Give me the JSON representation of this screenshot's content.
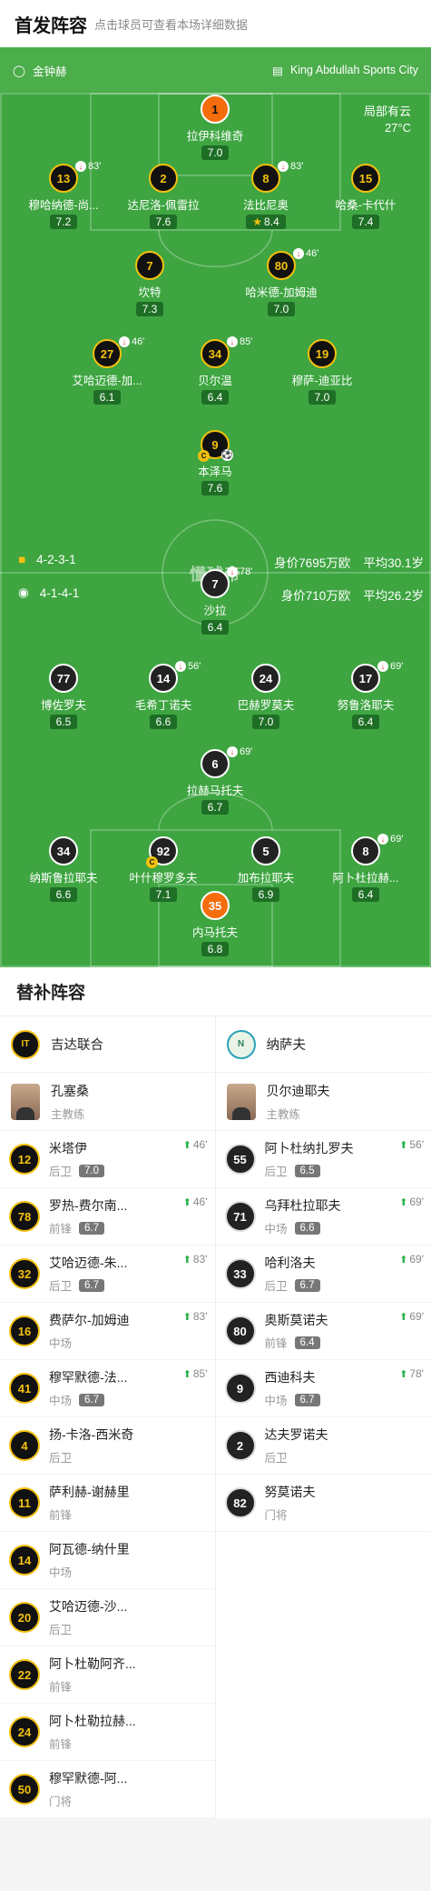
{
  "header": {
    "title": "首发阵容",
    "subtitle": "点击球员可查看本场详细数据"
  },
  "info": {
    "referee": "金钟赫",
    "stadium": "King Abdullah Sports City",
    "weather": "局部有云",
    "temperature": "27°C"
  },
  "home_lineup": {
    "formation": "4-2-3-1",
    "value_label": "身价7695万欧",
    "age_label": "平均30.1岁",
    "players": [
      {
        "num": "1",
        "name": "拉伊科维奇",
        "rating": "7.0",
        "gk": true
      },
      {
        "num": "13",
        "name": "穆哈纳德-尚...",
        "rating": "7.2",
        "sub": "83'"
      },
      {
        "num": "2",
        "name": "达尼洛-佩雷拉",
        "rating": "7.6"
      },
      {
        "num": "8",
        "name": "法比尼奥",
        "rating": "8.4",
        "sub": "83'",
        "star": true
      },
      {
        "num": "15",
        "name": "哈桑-卡代什",
        "rating": "7.4"
      },
      {
        "num": "7",
        "name": "坎特",
        "rating": "7.3"
      },
      {
        "num": "80",
        "name": "哈米德-加姆迪",
        "rating": "7.0",
        "sub": "46'"
      },
      {
        "num": "27",
        "name": "艾哈迈德-加...",
        "rating": "6.1",
        "sub": "46'"
      },
      {
        "num": "34",
        "name": "贝尔温",
        "rating": "6.4",
        "sub": "85'"
      },
      {
        "num": "19",
        "name": "穆萨-迪亚比",
        "rating": "7.0"
      },
      {
        "num": "9",
        "name": "本泽马",
        "rating": "7.6",
        "captain": true,
        "goal": true
      }
    ]
  },
  "away_lineup": {
    "formation": "4-1-4-1",
    "value_label": "身价710万欧",
    "age_label": "平均26.2岁",
    "players": [
      {
        "num": "7",
        "name": "沙拉",
        "rating": "6.4",
        "sub": "78'"
      },
      {
        "num": "77",
        "name": "博佐罗夫",
        "rating": "6.5"
      },
      {
        "num": "14",
        "name": "毛希丁诺夫",
        "rating": "6.6",
        "sub": "56'"
      },
      {
        "num": "24",
        "name": "巴赫罗莫夫",
        "rating": "7.0"
      },
      {
        "num": "17",
        "name": "努鲁洛耶夫",
        "rating": "6.4",
        "sub": "69'"
      },
      {
        "num": "6",
        "name": "拉赫马托夫",
        "rating": "6.7",
        "sub": "69'"
      },
      {
        "num": "34",
        "name": "纳斯鲁拉耶夫",
        "rating": "6.6"
      },
      {
        "num": "92",
        "name": "叶什穆罗多夫",
        "rating": "7.1",
        "captain": true
      },
      {
        "num": "5",
        "name": "加布拉耶夫",
        "rating": "6.9"
      },
      {
        "num": "8",
        "name": "阿卜杜拉赫...",
        "rating": "6.4",
        "sub": "69'"
      },
      {
        "num": "35",
        "name": "内马托夫",
        "rating": "6.8",
        "gk": true
      }
    ]
  },
  "watermark": "懂球帝",
  "subs": {
    "title": "替补阵容",
    "home": {
      "team": "吉达联合",
      "coach": "孔塞桑",
      "coach_role": "主教练",
      "players": [
        {
          "num": "12",
          "name": "米塔伊",
          "pos": "后卫",
          "rating": "7.0",
          "time": "46'"
        },
        {
          "num": "78",
          "name": "罗热-费尔南...",
          "pos": "前锋",
          "rating": "6.7",
          "time": "46'"
        },
        {
          "num": "32",
          "name": "艾哈迈德-朱...",
          "pos": "后卫",
          "rating": "6.7",
          "time": "83'"
        },
        {
          "num": "16",
          "name": "费萨尔-加姆迪",
          "pos": "中场",
          "rating": "",
          "time": "83'"
        },
        {
          "num": "41",
          "name": "穆罕默德-法...",
          "pos": "中场",
          "rating": "6.7",
          "time": "85'"
        },
        {
          "num": "4",
          "name": "扬-卡洛-西米奇",
          "pos": "后卫",
          "rating": "",
          "time": ""
        },
        {
          "num": "11",
          "name": "萨利赫-谢赫里",
          "pos": "前锋",
          "rating": "",
          "time": ""
        },
        {
          "num": "14",
          "name": "阿瓦德-纳什里",
          "pos": "中场",
          "rating": "",
          "time": ""
        },
        {
          "num": "20",
          "name": "艾哈迈德-沙...",
          "pos": "后卫",
          "rating": "",
          "time": ""
        },
        {
          "num": "22",
          "name": "阿卜杜勒阿齐...",
          "pos": "前锋",
          "rating": "",
          "time": ""
        },
        {
          "num": "24",
          "name": "阿卜杜勒拉赫...",
          "pos": "前锋",
          "rating": "",
          "time": ""
        },
        {
          "num": "50",
          "name": "穆罕默德-阿...",
          "pos": "门将",
          "rating": "",
          "time": ""
        }
      ]
    },
    "away": {
      "team": "纳萨夫",
      "coach": "贝尔迪耶夫",
      "coach_role": "主教练",
      "players": [
        {
          "num": "55",
          "name": "阿卜杜纳扎罗夫",
          "pos": "后卫",
          "rating": "6.5",
          "time": "56'"
        },
        {
          "num": "71",
          "name": "乌拜杜拉耶夫",
          "pos": "中场",
          "rating": "6.6",
          "time": "69'"
        },
        {
          "num": "33",
          "name": "哈利洛夫",
          "pos": "后卫",
          "rating": "6.7",
          "time": "69'"
        },
        {
          "num": "80",
          "name": "奥斯莫诺夫",
          "pos": "前锋",
          "rating": "6.4",
          "time": "69'"
        },
        {
          "num": "9",
          "name": "西迪科夫",
          "pos": "中场",
          "rating": "6.7",
          "time": "78'"
        },
        {
          "num": "2",
          "name": "达夫罗诺夫",
          "pos": "后卫",
          "rating": "",
          "time": ""
        },
        {
          "num": "82",
          "name": "努莫诺夫",
          "pos": "门将",
          "rating": "",
          "time": ""
        }
      ]
    }
  },
  "colors": {
    "pitch": "#3ea541",
    "home_border": "#f4c10f",
    "gk": "#f56c0c"
  }
}
